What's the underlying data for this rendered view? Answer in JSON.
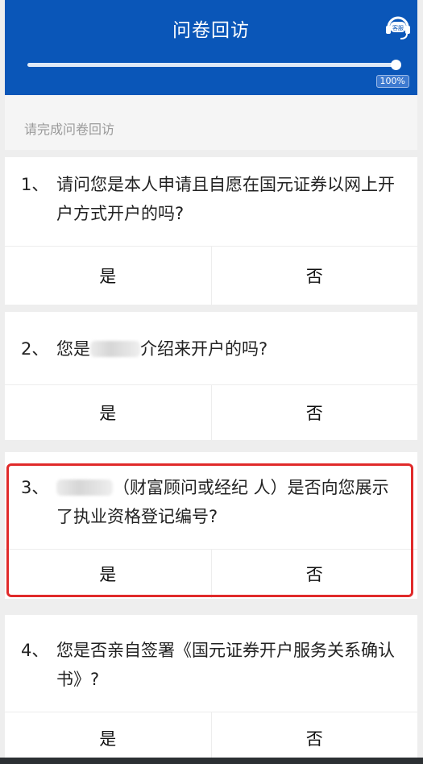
{
  "header": {
    "title": "问卷回访",
    "service_label": "客服",
    "progress": {
      "value": 1.0,
      "label": "100%"
    }
  },
  "subtitle": "请完成问卷回访",
  "questions": [
    {
      "number": "1、",
      "text": "请问您是本人申请且自愿在国元证券以网上开户方式开户的吗?",
      "answers": [
        "是",
        "否"
      ]
    },
    {
      "number": "2、",
      "text_before": "您是",
      "text_after": "介绍来开户的吗?",
      "answers": [
        "是",
        "否"
      ]
    },
    {
      "number": "3、",
      "text_after": "（财富顾问或经纪 人）是否向您展示了执业资格登记编号?",
      "answers": [
        "是",
        "否"
      ],
      "highlighted": true
    },
    {
      "number": "4、",
      "text": "您是否亲自签署《国元证券开户服务关系确认书》?",
      "answers": [
        "是",
        "否"
      ]
    }
  ],
  "colors": {
    "header_bg": "#0a56b8",
    "highlight": "#e02a2a"
  },
  "icons": {
    "service": "headset-icon"
  }
}
